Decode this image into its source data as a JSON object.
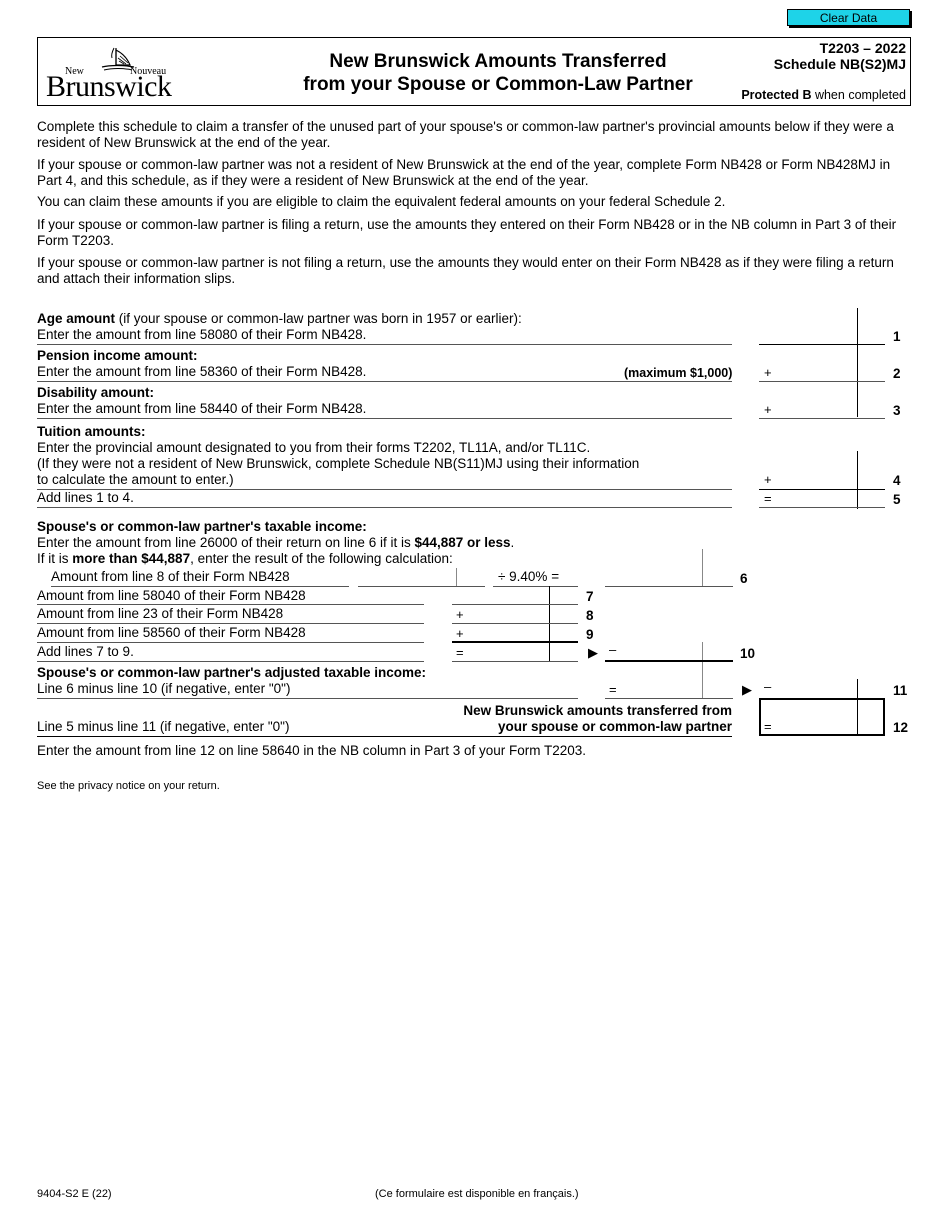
{
  "toolbar": {
    "clear_label": "Clear Data"
  },
  "header": {
    "logo": {
      "new": "New",
      "nouveau": "Nouveau",
      "brunswick": "Brunswick"
    },
    "title_line1": "New Brunswick Amounts Transferred",
    "title_line2": "from your Spouse or Common-Law Partner",
    "form_number": "T2203 – 2022",
    "schedule": "Schedule NB(S2)MJ",
    "protected_bold": "Protected B",
    "protected_rest": " when completed"
  },
  "intro": [
    "Complete this schedule to claim a transfer of the unused part of your spouse's or common-law partner's provincial amounts below if they were a resident of New Brunswick at the end of the year.",
    "If your spouse or common-law partner was not a resident of New Brunswick at the end of the year, complete Form NB428 or Form NB428MJ in Part 4, and this schedule, as if they were a resident of New Brunswick at the end of the year.",
    "You can claim these amounts if you are eligible to claim the equivalent federal amounts on your federal Schedule 2.",
    "If your spouse or common-law partner is filing a return, use the amounts they entered on their Form NB428 or in the NB column in Part 3 of their Form T2203.",
    "If your spouse or common-law partner is not filing a return, use the amounts they would enter on their Form NB428 as if they were filing a return and attach their information slips."
  ],
  "lines": {
    "l1": {
      "title": "Age amount",
      "title_rest": " (if your spouse or common-law partner was born in 1957 or earlier):",
      "text": "Enter the amount from line 58080 of their Form NB428.",
      "num": "1",
      "op": "",
      "value": ""
    },
    "l2": {
      "title": "Pension income amount:",
      "text": "Enter the amount from line 58360 of their Form NB428.",
      "note": "(maximum $1,000)",
      "num": "2",
      "op": "+",
      "value": ""
    },
    "l3": {
      "title": "Disability amount:",
      "text": "Enter the amount from line 58440 of their Form NB428.",
      "num": "3",
      "op": "+",
      "value": ""
    },
    "l4": {
      "title": "Tuition amounts:",
      "text1": "Enter the provincial amount designated to you from their forms T2202, TL11A, and/or TL11C.",
      "text2": "(If they were not a resident of New Brunswick, complete Schedule NB(S11)MJ using their information",
      "text3": "to calculate the amount to enter.)",
      "num": "4",
      "op": "+",
      "value": ""
    },
    "l5": {
      "text": "Add lines 1 to 4.",
      "num": "5",
      "op": "=",
      "value": ""
    },
    "l6": {
      "title": "Spouse's or common-law partner's taxable income:",
      "text1_a": "Enter the amount from line 26000 of their return on line 6 if it is ",
      "text1_b": "$44,887 or less",
      "text1_c": ".",
      "text2_a": "If it is ",
      "text2_b": "more than $44,887",
      "text2_c": ", enter the result of the following calculation:",
      "calc_label": "Amount from line 8 of their Form NB428",
      "calc_value": "",
      "divisor": "÷  9.40%  =",
      "num": "6",
      "value": ""
    },
    "l7": {
      "text": "Amount from line 58040 of their Form NB428",
      "num": "7",
      "op": "",
      "value": ""
    },
    "l8": {
      "text": "Amount from line 23 of their Form NB428",
      "num": "8",
      "op": "+",
      "value": ""
    },
    "l9": {
      "text": "Amount from line 58560 of their Form NB428",
      "num": "9",
      "op": "+",
      "value": ""
    },
    "l10": {
      "text": "Add lines 7 to 9.",
      "num": "10",
      "op": "=",
      "op_right": "–",
      "value": "",
      "value_right": ""
    },
    "l11": {
      "title": "Spouse's or common-law partner's adjusted taxable income:",
      "text": "Line 6 minus line 10 (if negative, enter \"0\")",
      "num": "11",
      "op": "=",
      "op_right": "–",
      "value": "",
      "value_right": ""
    },
    "l12": {
      "text": "Line 5 minus line 11 (if negative, enter \"0\")",
      "label1": "New Brunswick amounts transferred from",
      "label2": "your spouse or common-law partner",
      "num": "12",
      "op": "=",
      "value": ""
    }
  },
  "after": "Enter the amount from line 12 on line 58640 in the NB column in Part 3 of your Form T2203.",
  "privacy": "See the privacy notice on your return.",
  "footer": {
    "code": "9404-S2 E (22)",
    "french": "(Ce formulaire est disponible en français.)"
  },
  "colors": {
    "clear_button": "#1ed3e8"
  }
}
